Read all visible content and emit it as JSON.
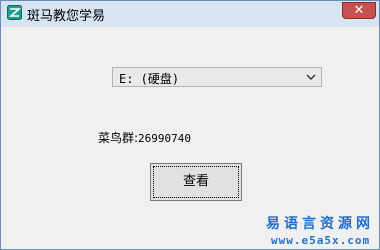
{
  "window": {
    "title": "斑马教您学易",
    "close_glyph": "✕"
  },
  "combo": {
    "selected": "E: (硬盘)"
  },
  "label": {
    "prefix": "菜鸟群:",
    "value": "26990740"
  },
  "button": {
    "label": "查看"
  },
  "watermark": {
    "site_name": "易语言资源网",
    "url": "www.e5a5x.com"
  },
  "colors": {
    "close": "#c75050",
    "titlebar": "#d7e4f2",
    "watermark": "#1f6fd1"
  },
  "icons": {
    "app": "zebra-app-icon",
    "combo_arrow": "chevron-down-icon"
  }
}
